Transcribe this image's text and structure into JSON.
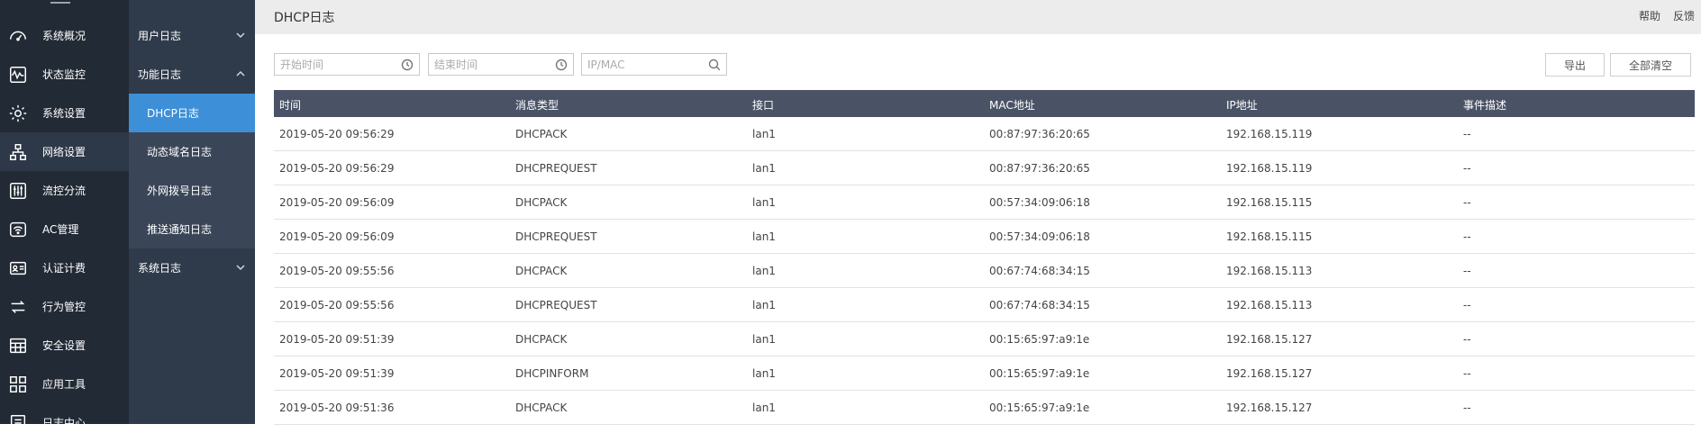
{
  "nav_primary": [
    {
      "label": "系统概况",
      "icon": "dashboard-icon"
    },
    {
      "label": "状态监控",
      "icon": "pulse-icon"
    },
    {
      "label": "系统设置",
      "icon": "gear-icon"
    },
    {
      "label": "网络设置",
      "icon": "network-icon"
    },
    {
      "label": "流控分流",
      "icon": "sliders-icon"
    },
    {
      "label": "AC管理",
      "icon": "wifi-icon"
    },
    {
      "label": "认证计费",
      "icon": "id-card-icon"
    },
    {
      "label": "行为管控",
      "icon": "arrows-icon"
    },
    {
      "label": "安全设置",
      "icon": "shield-icon"
    },
    {
      "label": "应用工具",
      "icon": "apps-icon"
    },
    {
      "label": "日志中心",
      "icon": "log-icon"
    }
  ],
  "nav_secondary": {
    "user_log": "用户日志",
    "function_log": "功能日志",
    "subs": [
      "DHCP日志",
      "动态域名日志",
      "外网拨号日志",
      "推送通知日志"
    ],
    "system_log": "系统日志"
  },
  "header": {
    "title": "DHCP日志",
    "help": "帮助",
    "feedback": "反馈"
  },
  "filters": {
    "start_placeholder": "开始时间",
    "end_placeholder": "结束时间",
    "ipmac_placeholder": "IP/MAC"
  },
  "actions": {
    "export": "导出",
    "clear_all": "全部清空"
  },
  "table": {
    "columns": [
      "时间",
      "消息类型",
      "接口",
      "MAC地址",
      "IP地址",
      "事件描述"
    ],
    "rows": [
      [
        "2019-05-20 09:56:29",
        "DHCPACK",
        "lan1",
        "00:87:97:36:20:65",
        "192.168.15.119",
        "--"
      ],
      [
        "2019-05-20 09:56:29",
        "DHCPREQUEST",
        "lan1",
        "00:87:97:36:20:65",
        "192.168.15.119",
        "--"
      ],
      [
        "2019-05-20 09:56:09",
        "DHCPACK",
        "lan1",
        "00:57:34:09:06:18",
        "192.168.15.115",
        "--"
      ],
      [
        "2019-05-20 09:56:09",
        "DHCPREQUEST",
        "lan1",
        "00:57:34:09:06:18",
        "192.168.15.115",
        "--"
      ],
      [
        "2019-05-20 09:55:56",
        "DHCPACK",
        "lan1",
        "00:67:74:68:34:15",
        "192.168.15.113",
        "--"
      ],
      [
        "2019-05-20 09:55:56",
        "DHCPREQUEST",
        "lan1",
        "00:67:74:68:34:15",
        "192.168.15.113",
        "--"
      ],
      [
        "2019-05-20 09:51:39",
        "DHCPACK",
        "lan1",
        "00:15:65:97:a9:1e",
        "192.168.15.127",
        "--"
      ],
      [
        "2019-05-20 09:51:39",
        "DHCPINFORM",
        "lan1",
        "00:15:65:97:a9:1e",
        "192.168.15.127",
        "--"
      ],
      [
        "2019-05-20 09:51:36",
        "DHCPACK",
        "lan1",
        "00:15:65:97:a9:1e",
        "192.168.15.127",
        "--"
      ]
    ]
  },
  "colors": {
    "nav_primary_bg": "#222a35",
    "nav_secondary_bg": "#2f3a4a",
    "active_blue": "#3d8fd8",
    "table_header_bg": "#4a5366"
  }
}
